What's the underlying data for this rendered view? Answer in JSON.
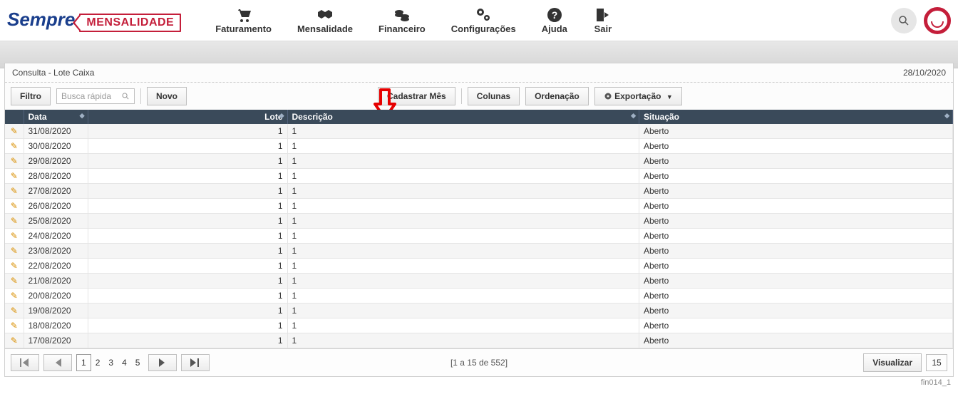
{
  "logo": {
    "text": "Sempre",
    "badge": "MENSALIDADE"
  },
  "nav": [
    {
      "label": "Faturamento",
      "name": "nav-faturamento"
    },
    {
      "label": "Mensalidade",
      "name": "nav-mensalidade"
    },
    {
      "label": "Financeiro",
      "name": "nav-financeiro"
    },
    {
      "label": "Configurações",
      "name": "nav-configuracoes"
    },
    {
      "label": "Ajuda",
      "name": "nav-ajuda"
    },
    {
      "label": "Sair",
      "name": "nav-sair"
    }
  ],
  "panel": {
    "title": "Consulta - Lote Caixa",
    "date": "28/10/2020"
  },
  "toolbar": {
    "filtro": "Filtro",
    "search_placeholder": "Busca rápida",
    "novo": "Novo",
    "cadastrar_mes": "Cadastrar Mês",
    "colunas": "Colunas",
    "ordenacao": "Ordenação",
    "exportacao": "Exportação"
  },
  "columns": {
    "data": "Data",
    "lote": "Lote",
    "descricao": "Descrição",
    "situacao": "Situação"
  },
  "rows": [
    {
      "data": "31/08/2020",
      "lote": "1",
      "descricao": "1",
      "situacao": "Aberto"
    },
    {
      "data": "30/08/2020",
      "lote": "1",
      "descricao": "1",
      "situacao": "Aberto"
    },
    {
      "data": "29/08/2020",
      "lote": "1",
      "descricao": "1",
      "situacao": "Aberto"
    },
    {
      "data": "28/08/2020",
      "lote": "1",
      "descricao": "1",
      "situacao": "Aberto"
    },
    {
      "data": "27/08/2020",
      "lote": "1",
      "descricao": "1",
      "situacao": "Aberto"
    },
    {
      "data": "26/08/2020",
      "lote": "1",
      "descricao": "1",
      "situacao": "Aberto"
    },
    {
      "data": "25/08/2020",
      "lote": "1",
      "descricao": "1",
      "situacao": "Aberto"
    },
    {
      "data": "24/08/2020",
      "lote": "1",
      "descricao": "1",
      "situacao": "Aberto"
    },
    {
      "data": "23/08/2020",
      "lote": "1",
      "descricao": "1",
      "situacao": "Aberto"
    },
    {
      "data": "22/08/2020",
      "lote": "1",
      "descricao": "1",
      "situacao": "Aberto"
    },
    {
      "data": "21/08/2020",
      "lote": "1",
      "descricao": "1",
      "situacao": "Aberto"
    },
    {
      "data": "20/08/2020",
      "lote": "1",
      "descricao": "1",
      "situacao": "Aberto"
    },
    {
      "data": "19/08/2020",
      "lote": "1",
      "descricao": "1",
      "situacao": "Aberto"
    },
    {
      "data": "18/08/2020",
      "lote": "1",
      "descricao": "1",
      "situacao": "Aberto"
    },
    {
      "data": "17/08/2020",
      "lote": "1",
      "descricao": "1",
      "situacao": "Aberto"
    }
  ],
  "pager": {
    "pages": [
      "1",
      "2",
      "3",
      "4",
      "5"
    ],
    "active": "1",
    "range": "[1 a 15 de 552]",
    "visualizar": "Visualizar",
    "page_size": "15"
  },
  "footer_id": "fin014_1"
}
